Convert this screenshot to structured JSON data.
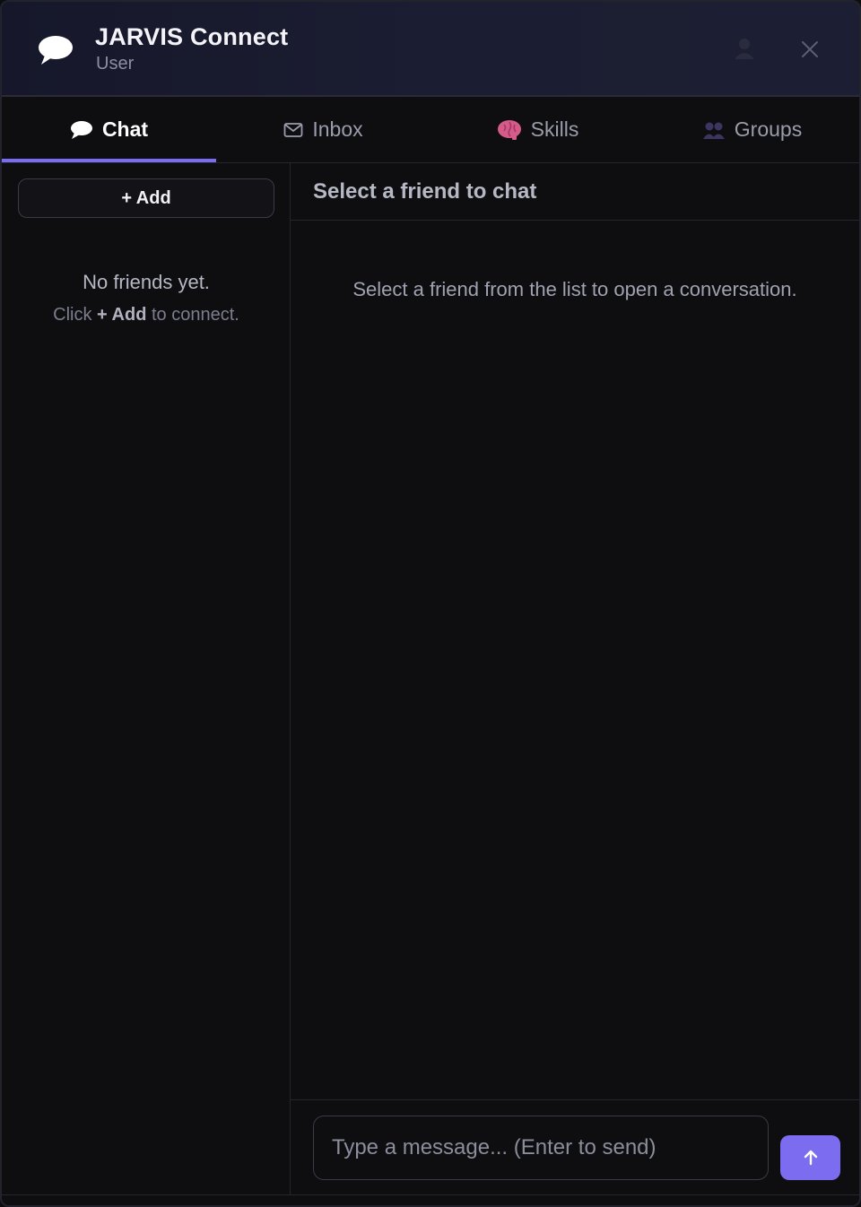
{
  "header": {
    "title": "JARVIS Connect",
    "subtitle": "User",
    "icons": [
      "speech-bubble-icon",
      "user-icon",
      "close-icon"
    ]
  },
  "tabs": [
    {
      "label": "Chat",
      "icon": "speech-bubble-icon",
      "active": true
    },
    {
      "label": "Inbox",
      "icon": "envelope-icon",
      "active": false
    },
    {
      "label": "Skills",
      "icon": "brain-icon",
      "active": false
    },
    {
      "label": "Groups",
      "icon": "people-icon",
      "active": false
    }
  ],
  "sidebar": {
    "add_button": "+ Add",
    "empty_title": "No friends yet.",
    "empty_hint_prefix": "Click ",
    "empty_hint_strong": "+ Add",
    "empty_hint_suffix": " to connect."
  },
  "main": {
    "heading": "Select a friend to chat",
    "placeholder_message": "Select a friend from the list to open a conversation."
  },
  "composer": {
    "placeholder": "Type a message... (Enter to send)",
    "value": "",
    "send_icon": "arrow-up-icon"
  },
  "colors": {
    "accent": "#7b6cf0",
    "header_bg": "#1b1d32",
    "panel_bg": "#0e0e11",
    "border": "#24252d"
  }
}
